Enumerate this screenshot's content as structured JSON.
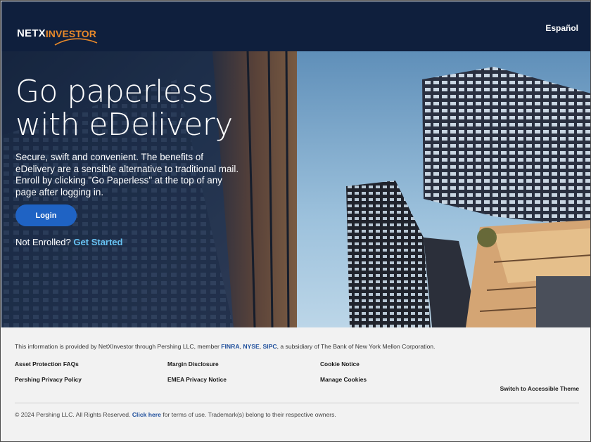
{
  "header": {
    "logo": {
      "part1": "NETX",
      "part2": "INVESTOR"
    },
    "language_link": "Español"
  },
  "hero": {
    "title_line1": "Go paperless",
    "title_line2": "with eDelivery",
    "description": "Secure, swift and convenient. The benefits of eDelivery are a sensible alternative to traditional mail. Enroll by clicking \"Go Paperless\" at the top of any page after logging in.",
    "login_button": "Login",
    "not_enrolled": "Not Enrolled?",
    "get_started": "Get Started"
  },
  "footer": {
    "info_prefix": "This information is provided by NetXInvestor through Pershing LLC, member ",
    "finra": "FINRA",
    "sep1": ", ",
    "nyse": "NYSE",
    "sep2": ", ",
    "sipc": "SIPC",
    "info_suffix": ", a subsidiary of The Bank of New York Mellon Corporation.",
    "links": {
      "asset_protection": "Asset Protection FAQs",
      "margin_disclosure": "Margin Disclosure",
      "cookie_notice": "Cookie Notice",
      "privacy_policy": "Pershing Privacy Policy",
      "emea_privacy": "EMEA Privacy Notice",
      "manage_cookies": "Manage Cookies",
      "accessible_theme": "Switch to Accessible Theme"
    },
    "copyright_prefix": "© 2024 Pershing LLC. All Rights Reserved. ",
    "click_here": "Click here",
    "copyright_suffix": " for terms of use. Trademark(s) belong to their respective owners."
  },
  "colors": {
    "header_bg": "#0f1f3d",
    "logo_accent": "#e8892a",
    "login_button": "#1f63c4",
    "get_started_link": "#66c2f2",
    "footer_link": "#1f4f9c",
    "footer_bg": "#f2f2f2"
  }
}
